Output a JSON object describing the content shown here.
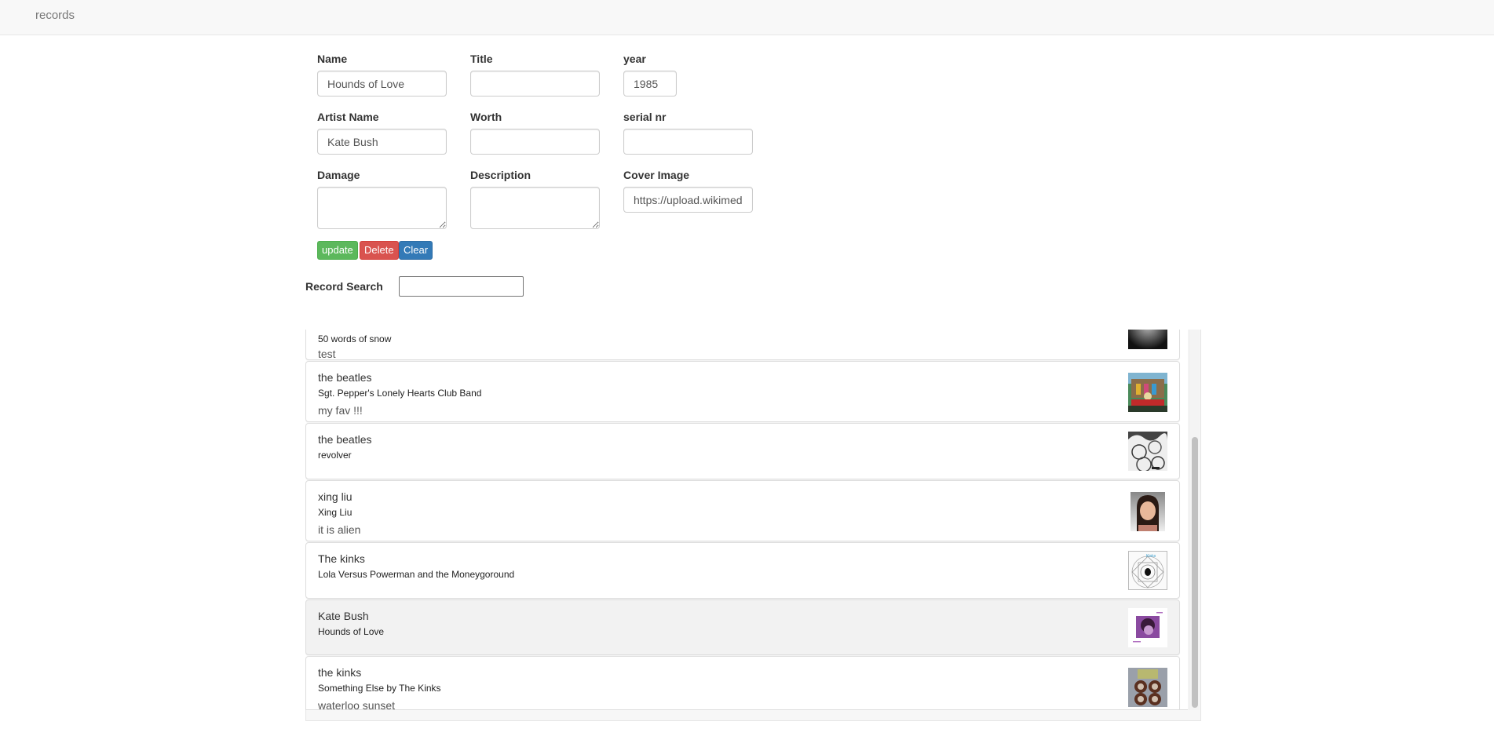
{
  "navbar": {
    "brand": "records"
  },
  "form": {
    "name": {
      "label": "Name",
      "value": "Hounds of Love"
    },
    "title": {
      "label": "Title",
      "value": ""
    },
    "year": {
      "label": "year",
      "value": "1985"
    },
    "artist_name": {
      "label": "Artist Name",
      "value": "Kate Bush"
    },
    "worth": {
      "label": "Worth",
      "value": ""
    },
    "serial_nr": {
      "label": "serial nr",
      "value": ""
    },
    "damage": {
      "label": "Damage",
      "value": ""
    },
    "description": {
      "label": "Description",
      "value": ""
    },
    "cover_image": {
      "label": "Cover Image",
      "value": "https://upload.wikimedia.org/"
    },
    "buttons": {
      "update": "update",
      "delete": "Delete",
      "clear": "Clear"
    }
  },
  "search": {
    "label": "Record Search",
    "value": ""
  },
  "colors": {
    "update": "#5cb85c",
    "delete": "#d9534f",
    "clear": "#337ab7",
    "selected_row": "#f2f2f2"
  },
  "records": [
    {
      "artist": "",
      "title": "50 words of snow",
      "description": "test",
      "cover": "dark-gray-cover-icon",
      "partially_visible": true
    },
    {
      "artist": "the beatles",
      "title": "Sgt. Pepper's Lonely Hearts Club Band",
      "description": "my fav !!!",
      "cover": "sgt-pepper-cover-icon"
    },
    {
      "artist": "the beatles",
      "title": "revolver",
      "description": "",
      "cover": "revolver-cover-icon"
    },
    {
      "artist": "xing liu",
      "title": "Xing Liu",
      "description": "it is alien",
      "cover": "portrait-photo-icon"
    },
    {
      "artist": "The kinks",
      "title": "Lola Versus Powerman and the Moneygoround",
      "description": "",
      "cover": "lola-cover-icon"
    },
    {
      "artist": "Kate Bush",
      "title": "Hounds of Love",
      "description": "",
      "cover": "hounds-of-love-cover-icon",
      "selected": true
    },
    {
      "artist": "the kinks",
      "title": "Something Else by The Kinks",
      "description": "waterloo sunset",
      "cover": "something-else-cover-icon"
    }
  ],
  "scroll": {
    "position_fraction": 1.0,
    "visible_fraction": 0.72
  }
}
